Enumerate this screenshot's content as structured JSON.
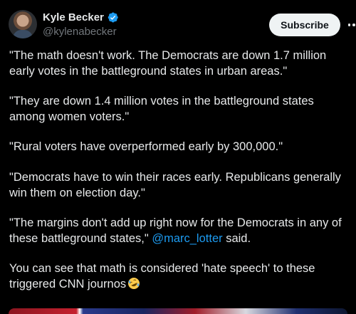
{
  "author": {
    "name": "Kyle Becker",
    "handle": "@kylenabecker",
    "verified_color": "#1d9bf0"
  },
  "actions": {
    "subscribe_label": "Subscribe",
    "more_icon": "more-horizontal-icon"
  },
  "tweet": {
    "paragraphs": [
      "\"The math doesn't work. The Democrats are down 1.7 million early votes in the battleground states in urban areas.\"",
      "\"They are down 1.4 million votes in the battleground states among women voters.\"",
      "\"Rural voters have overperformed early by 300,000.\"",
      "\"Democrats have to win their races early. Republicans generally win them on election day.\""
    ],
    "p5_text": "\"The margins don't add up right now for the Democrats in any of these battleground states,\"",
    "p5_mention": "@marc_lotter",
    "p5_suffix": " said.",
    "p6_text": "You can see that math is considered 'hate speech' to these triggered CNN journos",
    "emoji": "rolling-on-the-floor-laughing-emoji"
  },
  "colors": {
    "background": "#000000",
    "text": "#e7e9ea",
    "secondary_text": "#71767b",
    "link": "#1d9bf0"
  }
}
